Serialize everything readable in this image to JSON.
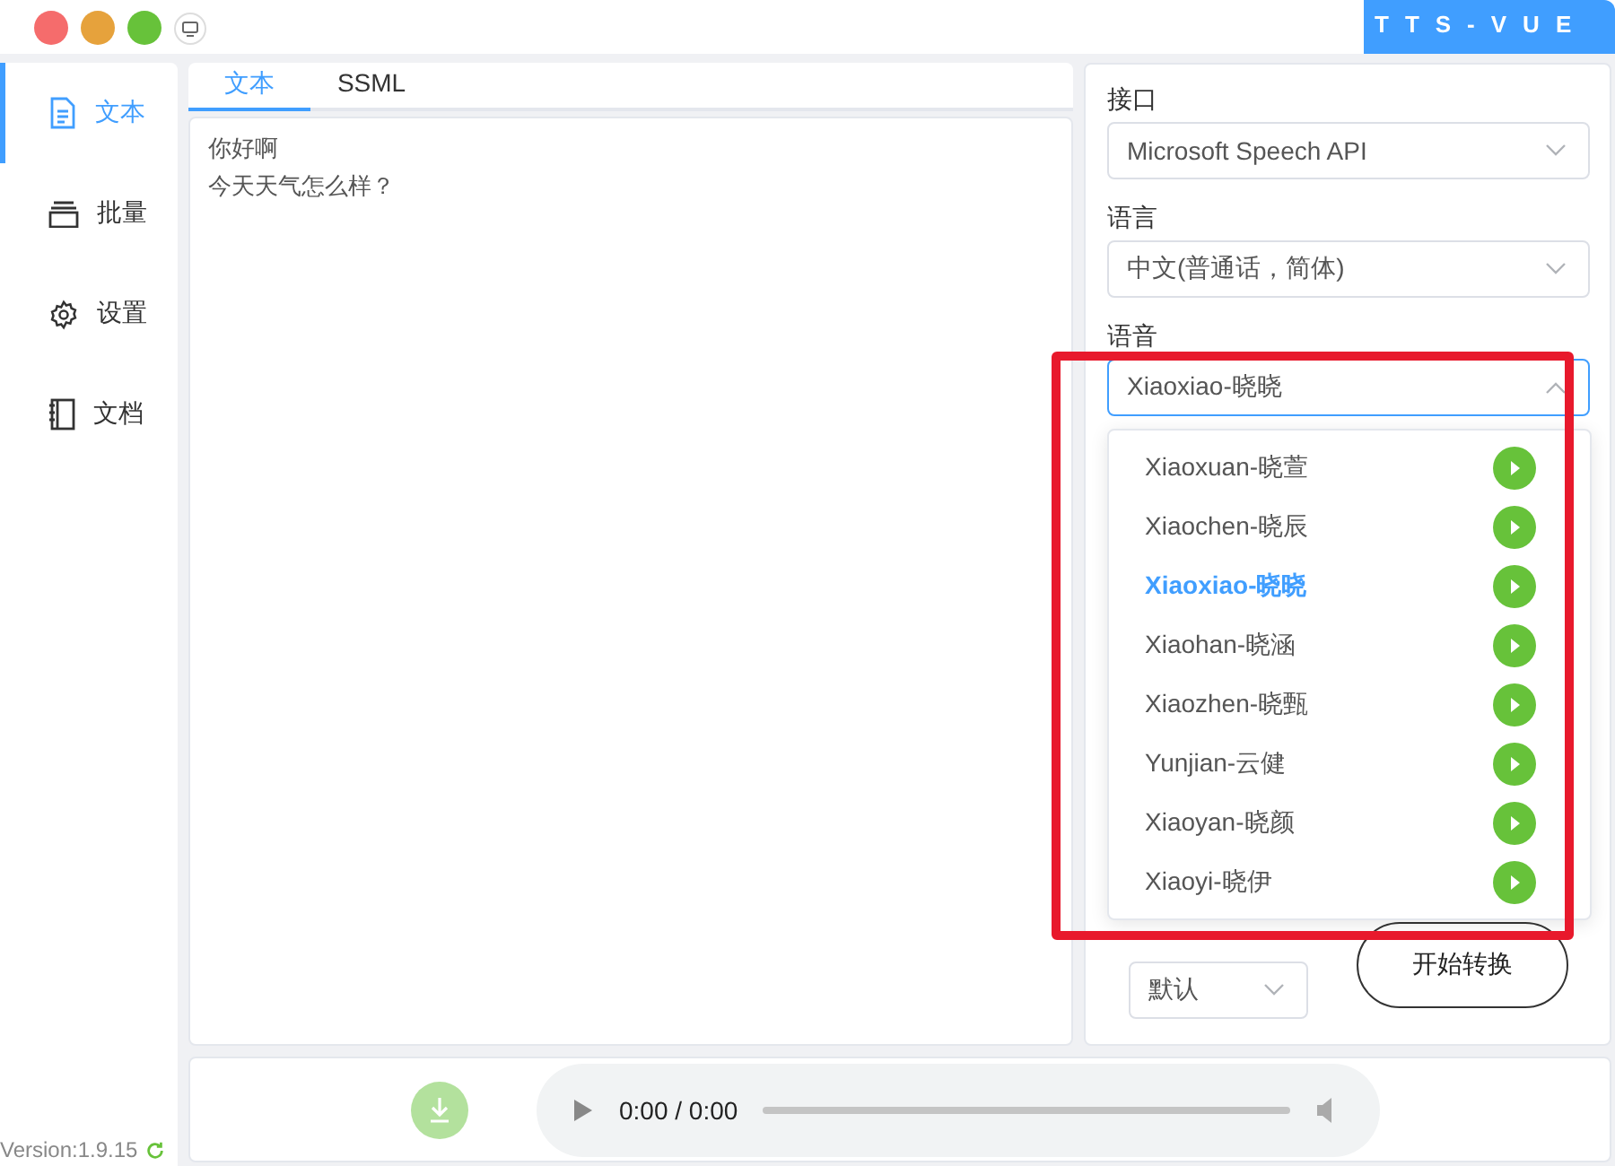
{
  "window": {
    "title": "TTS-VUE"
  },
  "sidebar": {
    "items": [
      {
        "label": "文本",
        "selected": true
      },
      {
        "label": "批量",
        "selected": false
      },
      {
        "label": "设置",
        "selected": false
      },
      {
        "label": "文档",
        "selected": false
      }
    ],
    "version": "Version:1.9.15"
  },
  "editor": {
    "tabs": [
      {
        "label": "文本",
        "selected": true
      },
      {
        "label": "SSML",
        "selected": false
      }
    ],
    "lines": [
      "你好啊",
      "今天天气怎么样？"
    ]
  },
  "settings": {
    "fields": [
      {
        "label": "接口",
        "value": "Microsoft Speech API",
        "open": false
      },
      {
        "label": "语言",
        "value": "中文(普通话，简体)",
        "open": false
      },
      {
        "label": "语音",
        "value": "Xiaoxiao-晓晓",
        "open": true
      }
    ],
    "voice_options": [
      {
        "label": "Xiaoxuan-晓萱",
        "selected": false
      },
      {
        "label": "Xiaochen-晓辰",
        "selected": false
      },
      {
        "label": "Xiaoxiao-晓晓",
        "selected": true
      },
      {
        "label": "Xiaohan-晓涵",
        "selected": false
      },
      {
        "label": "Xiaozhen-晓甄",
        "selected": false
      },
      {
        "label": "Yunjian-云健",
        "selected": false
      },
      {
        "label": "Xiaoyan-晓颜",
        "selected": false
      },
      {
        "label": "Xiaoyi-晓伊",
        "selected": false
      }
    ],
    "style_select": "默认",
    "start_button": "开始转换"
  },
  "player": {
    "time": "0:00 / 0:00"
  }
}
